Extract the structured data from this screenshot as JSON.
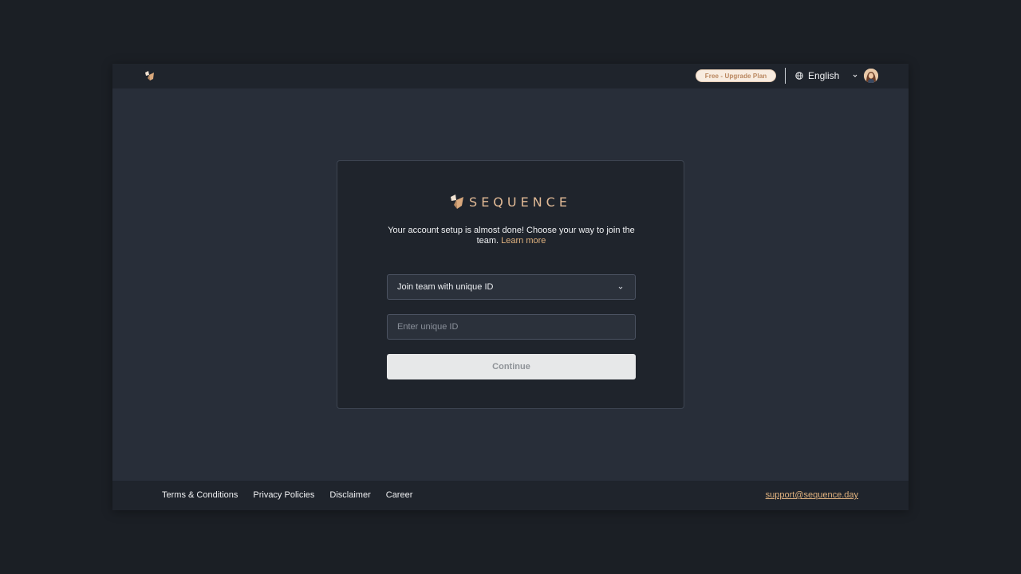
{
  "header": {
    "upgrade_badge": "Free - Upgrade Plan",
    "language": "English"
  },
  "card": {
    "brand_name": "SEQUENCE",
    "subtitle": "Your account setup is almost done! Choose your way to join the team.",
    "learn_more": "Learn more",
    "join_method": "Join team with unique ID",
    "unique_id_value": "",
    "unique_id_placeholder": "Enter unique ID",
    "continue_label": "Continue"
  },
  "footer": {
    "links": [
      "Terms & Conditions",
      "Privacy Policies",
      "Disclaimer",
      "Career"
    ],
    "support_email": "support@sequence.day"
  },
  "colors": {
    "accent": "#e0b27f",
    "background": "#282e39",
    "panel": "#1f242c"
  },
  "icons": {
    "app_logo": "sequence-logo-icon",
    "language": "globe-icon",
    "dropdown": "chevron-down-icon",
    "avatar": "user-avatar"
  }
}
